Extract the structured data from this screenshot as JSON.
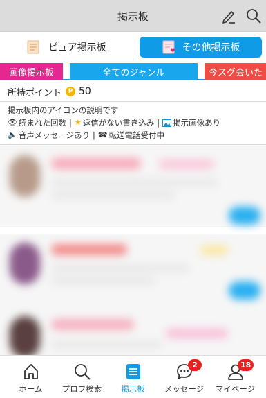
{
  "header": {
    "title": "掲示板"
  },
  "segments": {
    "pure_label": "ピュア掲示板",
    "other_label": "その他掲示板"
  },
  "tabs": [
    {
      "label": "画像掲示板",
      "color": "#e5288f"
    },
    {
      "label": "全てのジャンル",
      "color": "#1aa6ec"
    },
    {
      "label": "今スグ会いた",
      "color": "#ee4c44"
    }
  ],
  "points": {
    "label": "所持ポイント",
    "coin_symbol": "P",
    "value": "50"
  },
  "legend": {
    "title": "掲示板内のアイコンの説明です",
    "read_count": "読まれた回数",
    "no_reply": "返信がない書き込み",
    "has_image": "掲示画像あり",
    "voice_message": "音声メッセージあり",
    "call_transfer": "転送電話受付中",
    "separator": "|"
  },
  "nav": {
    "items": [
      {
        "label": "ホーム",
        "icon": "home-icon"
      },
      {
        "label": "プロフ検索",
        "icon": "search-icon"
      },
      {
        "label": "掲示板",
        "icon": "board-icon"
      },
      {
        "label": "メッセージ",
        "icon": "message-icon",
        "badge": "2"
      },
      {
        "label": "マイページ",
        "icon": "person-icon",
        "badge": "18"
      }
    ]
  },
  "colors": {
    "accent": "#0f9be6",
    "badge": "#e8231f",
    "header_bg": "#dcdcdc"
  }
}
